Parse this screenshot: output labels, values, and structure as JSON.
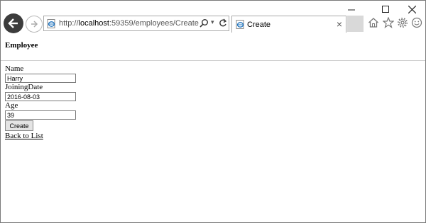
{
  "browser": {
    "address": {
      "protocol": "http://",
      "host": "localhost",
      "rest": ":59359/employees/Create"
    },
    "tab_title": "Create",
    "tab_close": "×"
  },
  "page": {
    "title": "Employee",
    "fields": [
      {
        "label": "Name",
        "value": "Harry"
      },
      {
        "label": "JoiningDate",
        "value": "2016-08-03"
      },
      {
        "label": "Age",
        "value": "39"
      }
    ],
    "submit_label": "Create",
    "back_link": "Back to List"
  }
}
